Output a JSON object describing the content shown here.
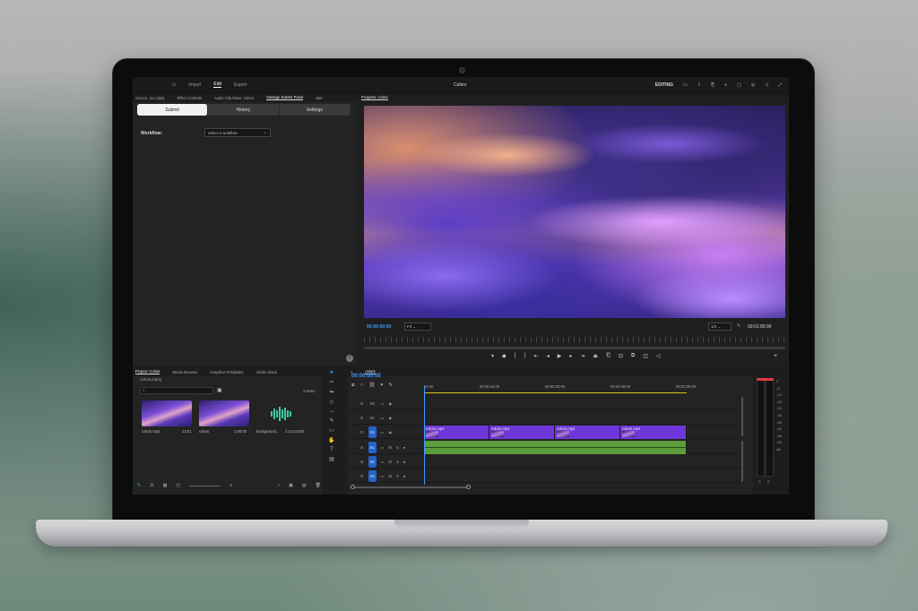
{
  "header": {
    "nav": [
      "Import",
      "Edit",
      "Export"
    ],
    "active_nav": "Edit",
    "title": "Colors",
    "workspace": "EDITING"
  },
  "source_panel": {
    "tabs": [
      "Source: (no clips)",
      "Effect Controls",
      "Audio Clip Mixer: colors",
      "Vantage Submit Panel",
      "Met"
    ],
    "active_tab": "Vantage Submit Panel",
    "segments": [
      "Submit",
      "History",
      "Settings"
    ],
    "workflow_label": "Workflow:",
    "workflow_placeholder": "Select a workflow",
    "help": "?"
  },
  "program": {
    "tab": "Program: colors",
    "timecode_in": "00:00:00:00",
    "fit": "Fit",
    "quality": "1/2",
    "timecode_out": "00:01:00:00"
  },
  "project": {
    "tabs": [
      "Project: Colors",
      "Media Browser",
      "Graphics Templates",
      "Adobe Stock"
    ],
    "active_tab": "Project: Colors",
    "file": "Colors.prproj",
    "item_count": "3 items",
    "items": [
      {
        "name": "colors.mp4",
        "duration": "13:01"
      },
      {
        "name": "colors",
        "duration": "1:00:00"
      },
      {
        "name": "background...",
        "duration": "2:14:21400"
      }
    ]
  },
  "timeline": {
    "tab": "colors",
    "timecode": "00:00:00:00",
    "ruler": [
      "00:00",
      "00:00:15:00",
      "00:00:30:00",
      "00:00:45:00",
      "00:01:00:00"
    ],
    "video_tracks": [
      "V3",
      "V2",
      "V1"
    ],
    "audio_tracks": [
      "A1",
      "A2",
      "A3"
    ],
    "audio_track_labels": [
      "M",
      "S"
    ],
    "clip_label": "colors.mp4"
  },
  "meter": {
    "scale": [
      "0",
      "-6",
      "-12",
      "-18",
      "-24",
      "-30",
      "-36",
      "-42",
      "-48",
      "-54",
      "dB"
    ],
    "footer": [
      "S",
      "S"
    ]
  },
  "colors": {
    "accent": "#3d9cff",
    "video_clip": "#6d37d9",
    "audio_clip": "#5b9c3c",
    "track_select": "#2563c9"
  }
}
